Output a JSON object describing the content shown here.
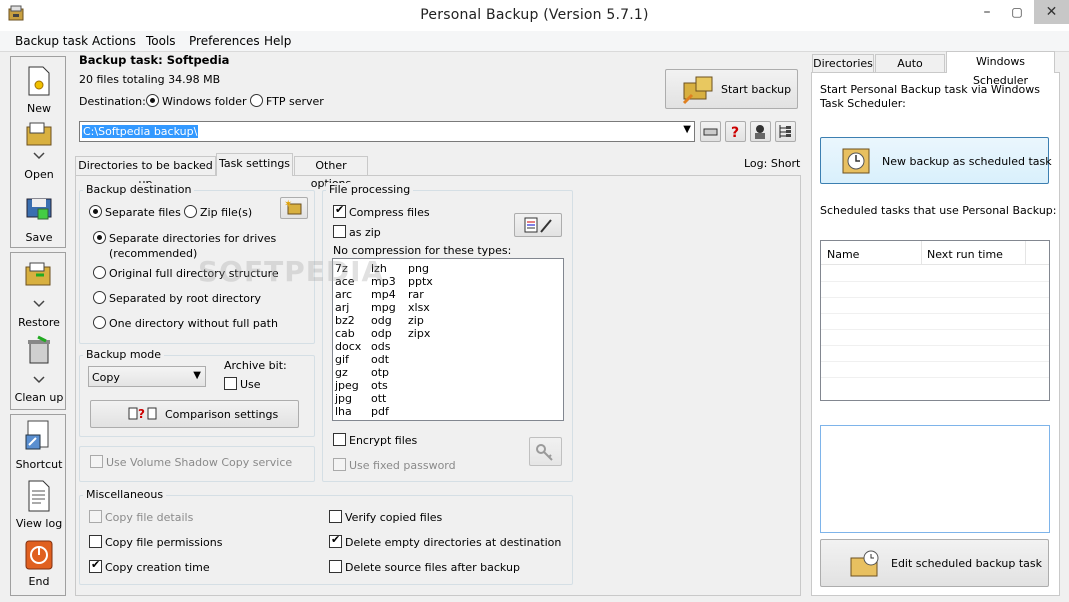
{
  "window": {
    "title": "Personal Backup (Version 5.7.1)",
    "minimize": "–",
    "restore": "▢",
    "close": "✕"
  },
  "menu": [
    "Backup task",
    "Actions",
    "Tools",
    "Preferences",
    "Help"
  ],
  "toolbar": {
    "new": "New",
    "open": "Open",
    "save": "Save",
    "restore": "Restore",
    "cleanup": "Clean up",
    "shortcut": "Shortcut",
    "viewlog": "View log",
    "end": "End"
  },
  "task": {
    "header": "Backup task: Softpedia",
    "summary": "20 files totaling 34.98 MB",
    "destination_label": "Destination:",
    "windows_folder": "Windows folder",
    "ftp_server": "FTP server",
    "path": "C:\\Softpedia backup\\",
    "start_backup": "Start backup",
    "log": "Log: Short"
  },
  "tabs": [
    "Directories to be backed up",
    "Task settings",
    "Other options"
  ],
  "backup_destination": {
    "title": "Backup destination",
    "separate_files": "Separate files",
    "zip_files": "Zip file(s)",
    "opt1": "Separate directories for drives",
    "opt1b": "(recommended)",
    "opt2": "Original full directory structure",
    "opt3": "Separated by root directory",
    "opt4": "One directory without full path"
  },
  "backup_mode": {
    "title": "Backup mode",
    "value": "Copy",
    "archive_bit": "Archive bit:",
    "use": "Use",
    "comparison": "Comparison settings"
  },
  "shadow": "Use Volume Shadow Copy service",
  "file_processing": {
    "title": "File processing",
    "compress": "Compress files",
    "as_zip": "as zip",
    "no_compression": "No compression for these types:",
    "col1": [
      "7z",
      "ace",
      "arc",
      "arj",
      "bz2",
      "cab",
      "docx",
      "gif",
      "gz",
      "jpeg",
      "jpg",
      "lha"
    ],
    "col2": [
      "lzh",
      "mp3",
      "mp4",
      "mpg",
      "odg",
      "odp",
      "ods",
      "odt",
      "otp",
      "ots",
      "ott",
      "pdf"
    ],
    "col3": [
      "png",
      "pptx",
      "rar",
      "xlsx",
      "zip",
      "zipx"
    ],
    "encrypt": "Encrypt files",
    "fixed_password": "Use fixed password"
  },
  "misc": {
    "title": "Miscellaneous",
    "copy_details": "Copy file details",
    "copy_permissions": "Copy file permissions",
    "copy_creation": "Copy creation time",
    "verify": "Verify copied files",
    "delete_empty": "Delete empty directories at destination",
    "delete_source": "Delete source files after backup"
  },
  "right": {
    "tabs": [
      "Directories",
      "Auto Backup",
      "Windows Scheduler"
    ],
    "intro": "Start Personal Backup task via Windows Task Scheduler:",
    "new_scheduled": "New backup as scheduled task",
    "scheduled_label": "Scheduled tasks that use Personal Backup:",
    "col_name": "Name",
    "col_next": "Next run time",
    "edit_scheduled": "Edit scheduled backup task"
  },
  "watermark": "SOFTPEDIA"
}
